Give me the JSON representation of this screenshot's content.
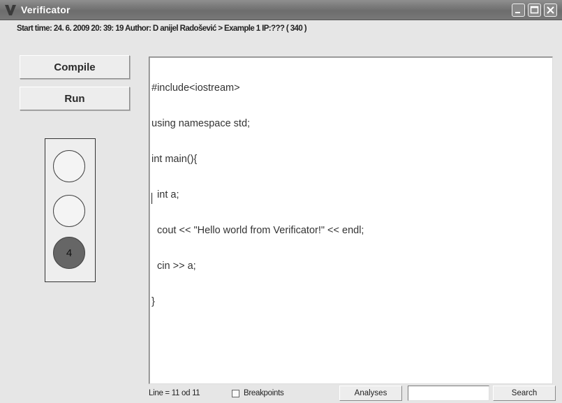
{
  "window": {
    "title": "Verificator",
    "app_icon": "v-logo-icon",
    "controls": [
      "minimize-icon",
      "maximize-icon",
      "close-icon"
    ]
  },
  "status_line": "Start time: 24. 6. 2009 20: 39: 19 Author: D anijel Radošević > Example 1 IP:??? ( 340 )",
  "buttons": {
    "compile": "Compile",
    "run": "Run"
  },
  "traffic_light": {
    "lights": [
      {
        "label": "",
        "state": "off"
      },
      {
        "label": "",
        "state": "off"
      },
      {
        "label": "4",
        "state": "on"
      }
    ]
  },
  "editor": {
    "lines": [
      "#include<iostream>",
      "using namespace std;",
      "int main(){",
      "  int a;",
      "  cout << \"Hello world from Verificator!\" << endl;",
      "  cin >> a;",
      "}"
    ]
  },
  "bottom_bar": {
    "line_info": "Line = 11 od 11",
    "breakpoints_label": "Breakpoints",
    "breakpoints_checked": false,
    "analyses_label": "Analyses",
    "search_value": "",
    "search_label": "Search"
  },
  "colors": {
    "titlebar": "#7a7a7a",
    "background": "#e6e6e6",
    "active_light": "#666666"
  }
}
